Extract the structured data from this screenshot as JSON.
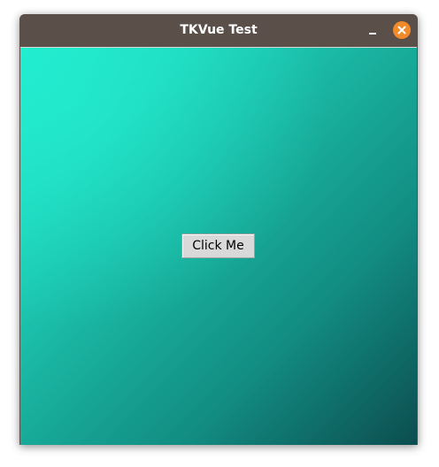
{
  "window": {
    "title": "TKVue Test",
    "minimize_icon": "minimize-icon",
    "close_icon": "close-icon",
    "close_color": "#f08a2a",
    "titlebar_color": "#5a4f49"
  },
  "content": {
    "gradient_colors": [
      "#21ecd0",
      "#18ad9b",
      "#0c4d4f"
    ],
    "button_label": "Click Me"
  }
}
